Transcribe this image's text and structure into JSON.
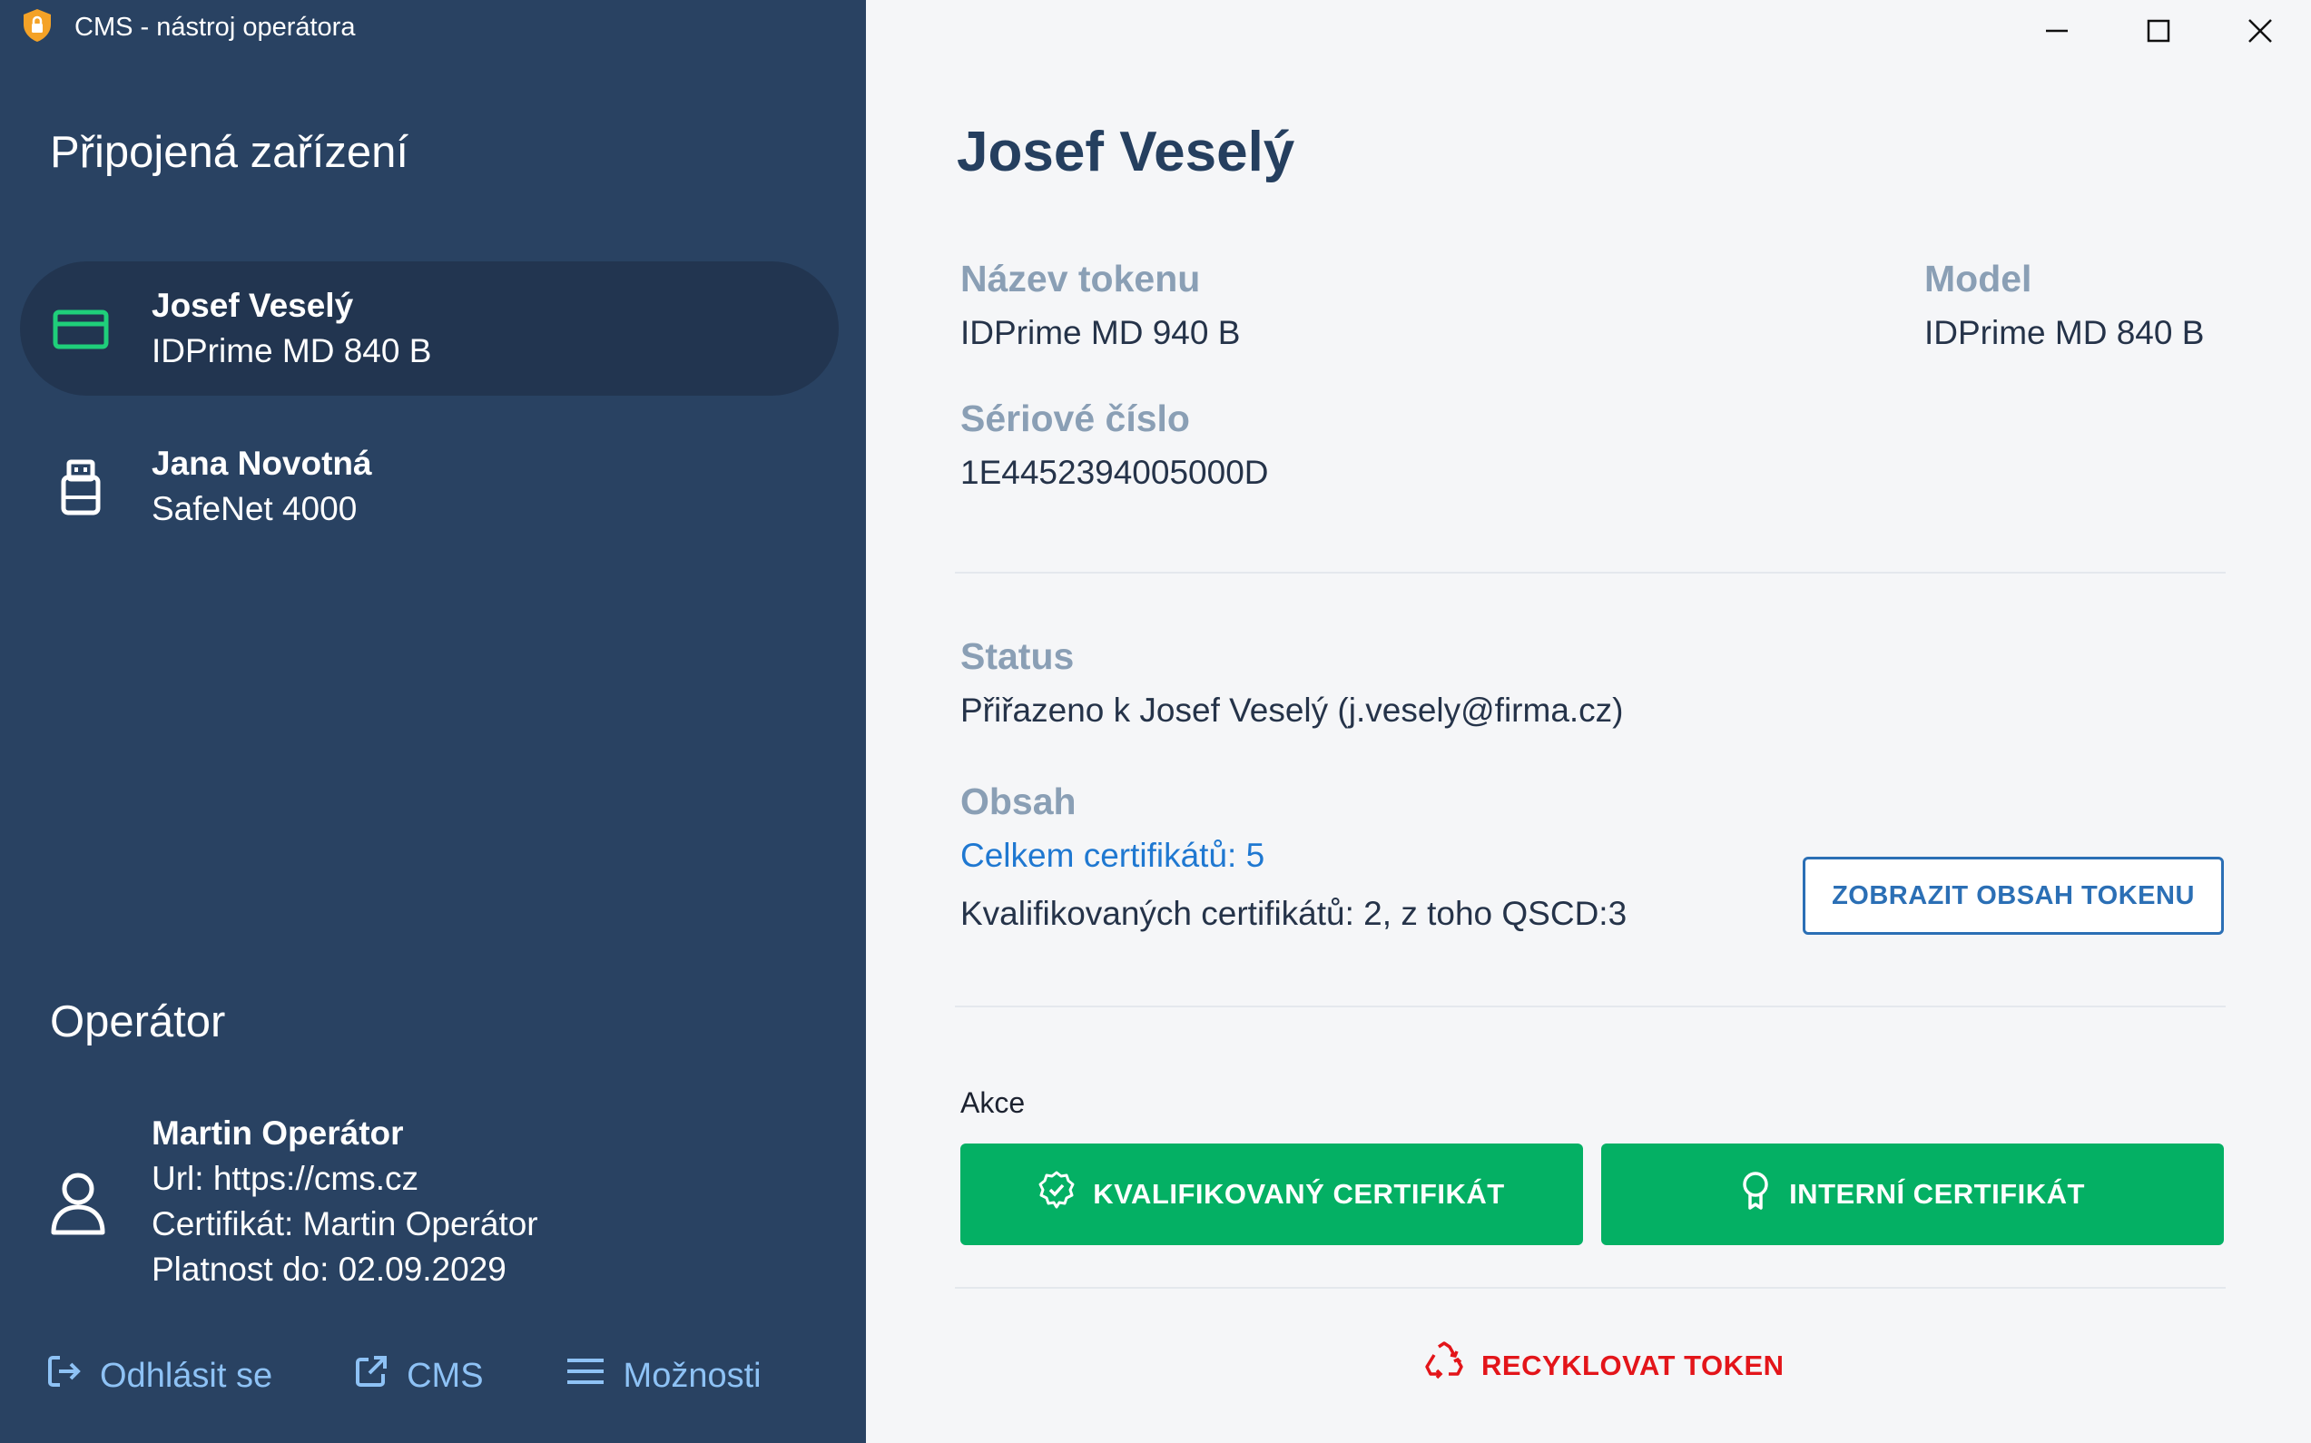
{
  "window": {
    "title": "CMS - nástroj operátora"
  },
  "sidebar": {
    "devices_title": "Připojená zařízení",
    "devices": [
      {
        "name": "Josef Veselý",
        "model": "IDPrime MD 840 B",
        "icon": "smart-card-icon",
        "active": true
      },
      {
        "name": "Jana Novotná",
        "model": "SafeNet 4000",
        "icon": "usb-token-icon",
        "active": false
      }
    ],
    "operator_title": "Operátor",
    "operator": {
      "name": "Martin Operátor",
      "url": "Url: https://cms.cz",
      "certificate": "Certifikát: Martin Operátor",
      "validity": "Platnost do: 02.09.2029"
    },
    "footer": {
      "logout": "Odhlásit se",
      "cms": "CMS",
      "options": "Možnosti"
    }
  },
  "detail": {
    "holder_name": "Josef Veselý",
    "token_name_label": "Název tokenu",
    "token_name": "IDPrime MD 940 B",
    "model_label": "Model",
    "model": "IDPrime MD 840 B",
    "serial_label": "Sériové číslo",
    "serial": "1E4452394005000D",
    "status_label": "Status",
    "status": "Přiřazeno k Josef Veselý (j.vesely@firma.cz)",
    "content_label": "Obsah",
    "total_certs": "Celkem certifikátů: 5",
    "qualified_certs": "Kvalifikovaných certifikátů: 2, z toho QSCD:3",
    "show_content_button": "ZOBRAZIT OBSAH TOKENU",
    "actions_label": "Akce",
    "qualified_button": "KVALIFIKOVANÝ CERTIFIKÁT",
    "internal_button": "INTERNÍ CERTIFIKÁT",
    "recycle_button": "RECYKLOVAT TOKEN"
  },
  "colors": {
    "sidebar_bg": "#294262",
    "active_item_bg": "#223550",
    "accent_green": "#04b064",
    "link_blue": "#1f78d1",
    "danger_red": "#e3151a",
    "label_gray": "#8a9fb5"
  }
}
